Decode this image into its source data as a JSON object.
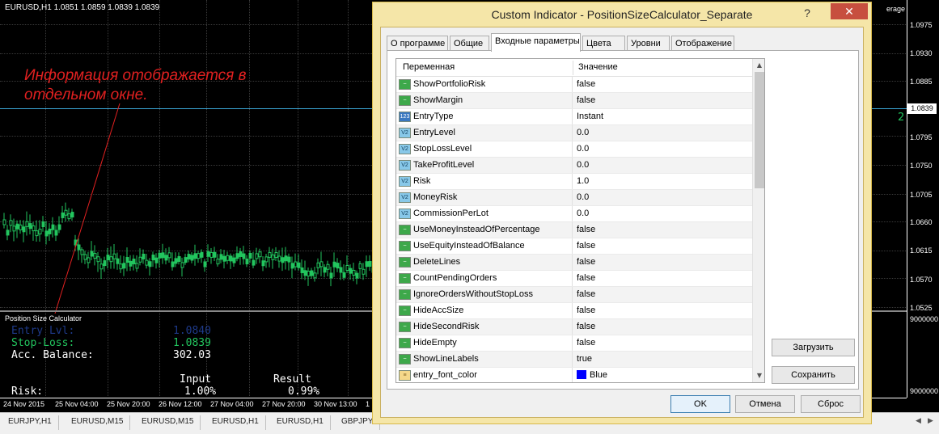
{
  "chart": {
    "title": "EURUSD,H1  1.0851 1.0859 1.0839 1.0839",
    "leverage_fragment": "erage",
    "price_tag": "1.0839",
    "marker": "2",
    "annotation_line1": "Информация отображается в",
    "annotation_line2": "отдельном окне.",
    "price_levels": [
      "1.0975",
      "1.0930",
      "1.0885",
      "1.0795",
      "1.0750",
      "1.0705",
      "1.0660",
      "1.0615",
      "1.0570",
      "1.0525"
    ],
    "time_labels": [
      "24 Nov 2015",
      "25 Nov 04:00",
      "25 Nov 20:00",
      "26 Nov 12:00",
      "27 Nov 04:00",
      "27 Nov 20:00",
      "30 Nov 13:00",
      "1"
    ],
    "candle_color": "#22c55e"
  },
  "subwindow": {
    "title": "Position Size Calculator",
    "axis_top": "9000000",
    "axis_bottom": "9000000",
    "entry_label": "Entry Lvl:",
    "entry_value": "1.0840",
    "stoploss_label": "Stop-Loss:",
    "stoploss_value": "1.0839",
    "balance_label": "Acc. Balance:",
    "balance_value": "302.03",
    "input_header": "Input",
    "result_header": "Result",
    "risk_label": "Risk:",
    "risk_input": "1.00%",
    "risk_result": "0.99%",
    "entry_color": "#1e3a8a",
    "stoploss_color": "#22c55e"
  },
  "bottom_tabs": [
    "EURJPY,H1",
    "EURUSD,M15",
    "EURUSD,M15",
    "EURUSD,H1",
    "EURUSD,H1",
    "GBPJPY"
  ],
  "dialog": {
    "title": "Custom Indicator - PositionSizeCalculator_Separate",
    "help": "?",
    "close": "✕",
    "tabs": [
      "О программе",
      "Общие",
      "Входные параметры",
      "Цвета",
      "Уровни",
      "Отображение"
    ],
    "active_tab": 2,
    "col_variable": "Переменная",
    "col_value": "Значение",
    "params": [
      {
        "icon": "bool",
        "icon_text": "~",
        "name": "ShowPortfolioRisk",
        "value": "false"
      },
      {
        "icon": "bool",
        "icon_text": "~",
        "name": "ShowMargin",
        "value": "false"
      },
      {
        "icon": "int",
        "icon_text": "123",
        "name": "EntryType",
        "value": "Instant"
      },
      {
        "icon": "num",
        "icon_text": "V2",
        "name": "EntryLevel",
        "value": "0.0"
      },
      {
        "icon": "num",
        "icon_text": "V2",
        "name": "StopLossLevel",
        "value": "0.0"
      },
      {
        "icon": "num",
        "icon_text": "V2",
        "name": "TakeProfitLevel",
        "value": "0.0"
      },
      {
        "icon": "num",
        "icon_text": "V2",
        "name": "Risk",
        "value": "1.0"
      },
      {
        "icon": "num",
        "icon_text": "V2",
        "name": "MoneyRisk",
        "value": "0.0"
      },
      {
        "icon": "num",
        "icon_text": "V2",
        "name": "CommissionPerLot",
        "value": "0.0"
      },
      {
        "icon": "bool",
        "icon_text": "~",
        "name": "UseMoneyInsteadOfPercentage",
        "value": "false"
      },
      {
        "icon": "bool",
        "icon_text": "~",
        "name": "UseEquityInsteadOfBalance",
        "value": "false"
      },
      {
        "icon": "bool",
        "icon_text": "~",
        "name": "DeleteLines",
        "value": "false"
      },
      {
        "icon": "bool",
        "icon_text": "~",
        "name": "CountPendingOrders",
        "value": "false"
      },
      {
        "icon": "bool",
        "icon_text": "~",
        "name": "IgnoreOrdersWithoutStopLoss",
        "value": "false"
      },
      {
        "icon": "bool",
        "icon_text": "~",
        "name": "HideAccSize",
        "value": "false"
      },
      {
        "icon": "bool",
        "icon_text": "~",
        "name": "HideSecondRisk",
        "value": "false"
      },
      {
        "icon": "bool",
        "icon_text": "~",
        "name": "HideEmpty",
        "value": "false"
      },
      {
        "icon": "bool",
        "icon_text": "~",
        "name": "ShowLineLabels",
        "value": "true"
      },
      {
        "icon": "color",
        "icon_text": "≡",
        "name": "entry_font_color",
        "value": "Blue",
        "swatch": "#0000ff"
      }
    ],
    "load_button": "Загрузить",
    "save_button": "Сохранить",
    "ok_button": "OK",
    "cancel_button": "Отмена",
    "reset_button": "Сброс"
  }
}
